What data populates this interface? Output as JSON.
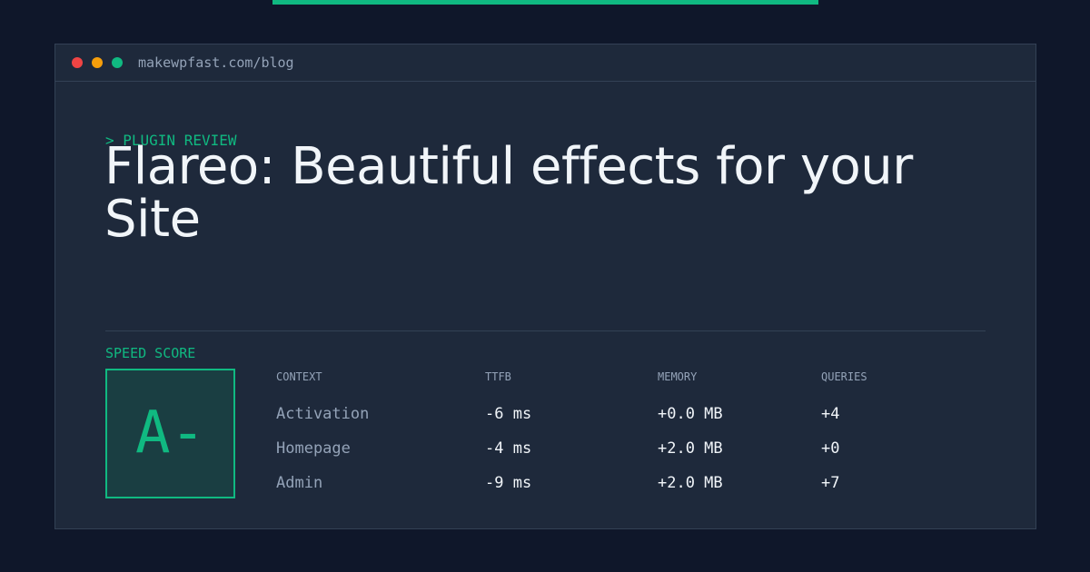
{
  "colors": {
    "background": "#0f172a",
    "panel": "#1e293b",
    "accent": "#10b981",
    "muted": "#94a3b8",
    "text": "#f1f5f9"
  },
  "window": {
    "url": "makewpfast.com/blog",
    "controls": [
      "close-dot",
      "minimize-dot",
      "maximize-dot"
    ]
  },
  "article": {
    "kicker": "> PLUGIN REVIEW",
    "title": "Flareo: Beautiful effects for your Site"
  },
  "speed": {
    "label": "SPEED SCORE",
    "grade": "A-"
  },
  "table": {
    "headers": [
      "CONTEXT",
      "TTFB",
      "MEMORY",
      "QUERIES"
    ],
    "rows": [
      [
        "Activation",
        "-6 ms",
        "+0.0 MB",
        "+4"
      ],
      [
        "Homepage",
        "-4 ms",
        "+2.0 MB",
        "+0"
      ],
      [
        "Admin",
        "-9 ms",
        "+2.0 MB",
        "+7"
      ]
    ]
  }
}
